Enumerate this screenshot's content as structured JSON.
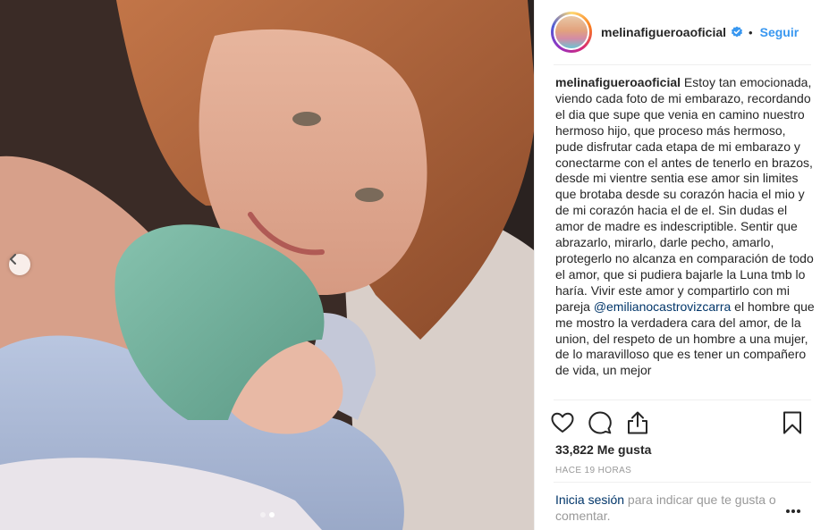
{
  "post": {
    "username": "melinafigueroaoficial",
    "separator": "•",
    "follow_label": "Seguir",
    "caption_username": "melinafigueroaoficial",
    "caption_part1": " Estoy tan emocionada, viendo cada foto de mi embarazo, recordando el dia que supe que venia en camino nuestro hermoso hijo, que proceso más hermoso, pude disfrutar cada etapa de mi embarazo y conectarme con el antes de tenerlo en brazos, desde mi vientre sentia ese amor sin limites que brotaba desde su corazón hacia el mio y de mi corazón hacia el de el. Sin dudas el amor de madre es indescriptible. Sentir que abrazarlo, mirarlo, darle pecho, amarlo, protegerlo no alcanza en comparación de todo el amor, que si pudiera bajarle la Luna tmb lo haría. Vivir este amor y compartirlo con mi pareja ",
    "mention": "@emilianocastrovizcarra",
    "caption_part2": " el hombre que me mostro la verdadera cara del amor, de la union, del respeto de un hombre a una mujer, de lo maravilloso que es tener un compañero de vida, un mejor",
    "likes": "33,822 Me gusta",
    "time": "HACE 19 HORAS",
    "login_link": "Inicia sesión",
    "login_text": " para indicar que te gusta o comentar."
  },
  "icons": {
    "verified": "verified-badge-icon",
    "like": "heart-icon",
    "comment": "comment-icon",
    "share": "share-icon",
    "save": "bookmark-icon",
    "more": "more-icon",
    "prev": "chevron-left-icon"
  },
  "carousel": {
    "total": 2,
    "current": 2
  },
  "colors": {
    "link": "#3897f0",
    "mention": "#003569",
    "muted": "#999999",
    "verified": "#3897f0"
  }
}
